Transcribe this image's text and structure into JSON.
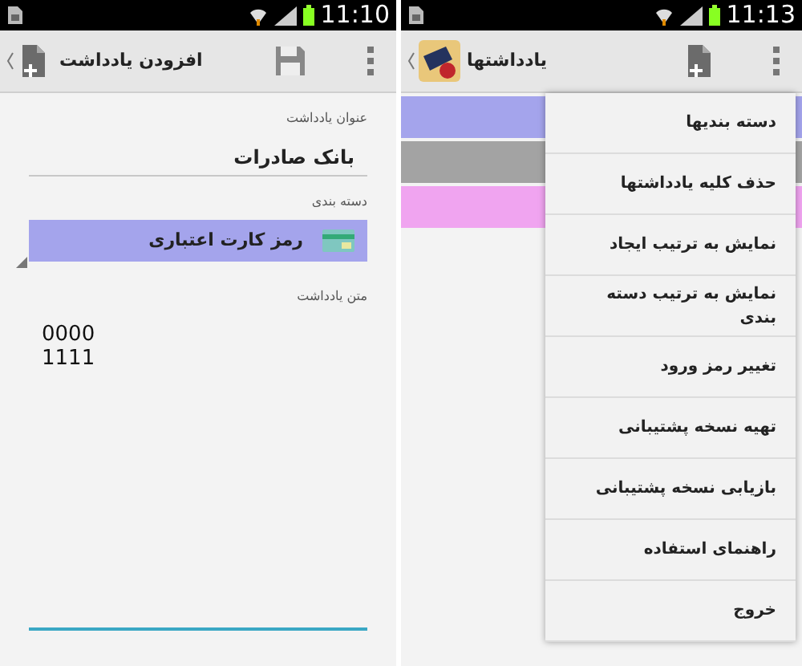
{
  "left_screen": {
    "status_bar": {
      "time": "11:10"
    },
    "action_bar": {
      "title": "افزودن یادداشت"
    },
    "title_field": {
      "label": "عنوان یادداشت",
      "value": "بانک صادرات"
    },
    "category_field": {
      "label": "دسته بندی",
      "value": "رمز کارت اعتباری",
      "color": "#a4a4ec"
    },
    "note_field": {
      "label": "متن یادداشت",
      "value": "0000\n1111"
    }
  },
  "right_screen": {
    "status_bar": {
      "time": "11:13"
    },
    "action_bar": {
      "title": "یادداشتها"
    },
    "notes": [
      {
        "color": "#a4a4ec"
      },
      {
        "color": "#a3a3a3"
      },
      {
        "color": "#f0a4f0"
      }
    ],
    "menu": [
      "دسته بندیها",
      "حذف کلیه یادداشتها",
      "نمایش به ترتیب ایجاد",
      "نمایش به ترتیب دسته بندی",
      "تغییر رمز ورود",
      "تهیه نسخه پشتیبانی",
      "بازیابی نسخه پشتیبانی",
      "راهنمای استفاده",
      "خروج"
    ]
  }
}
